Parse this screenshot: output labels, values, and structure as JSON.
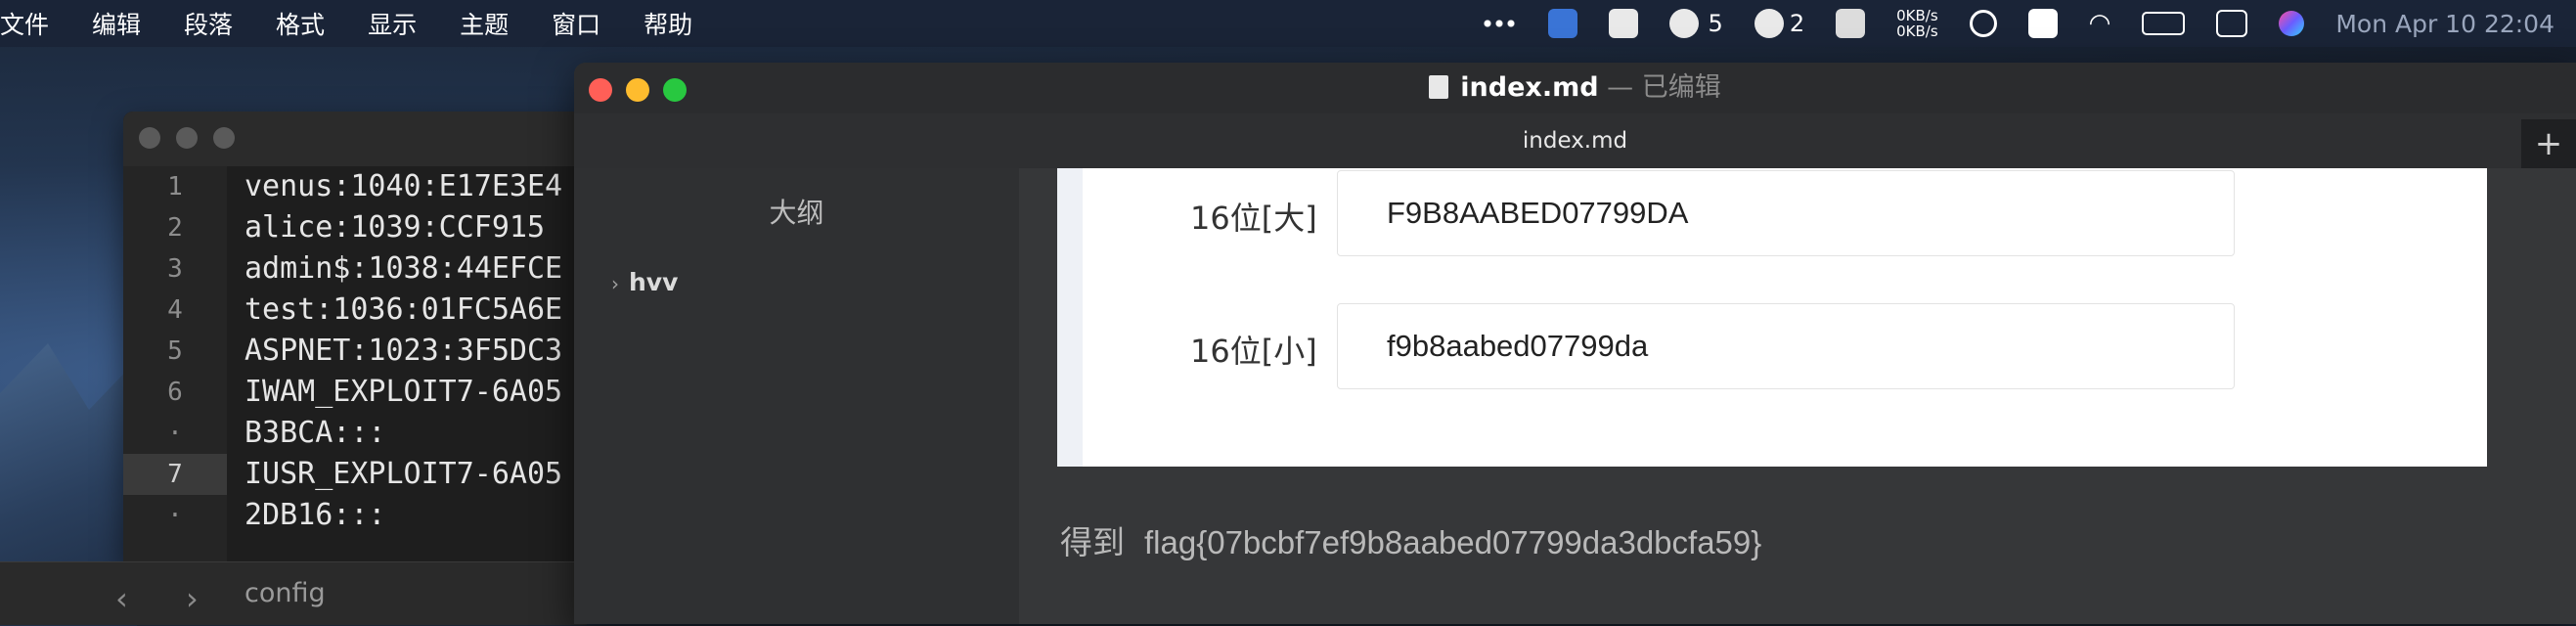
{
  "menubar": {
    "menus": [
      "文件",
      "编辑",
      "段落",
      "格式",
      "显示",
      "主题",
      "窗口",
      "帮助"
    ],
    "wechat_count": "5",
    "qq_count": "2",
    "net_up": "0KB/s",
    "net_down": "0KB/s",
    "clock": "Mon Apr 10  22:04"
  },
  "code_window": {
    "line_numbers": [
      "1",
      "2",
      "3",
      "4",
      "5",
      "6",
      "·",
      "7",
      "·"
    ],
    "lines": [
      "venus:1040:E17E3E4",
      "alice:1039:CCF915",
      "admin$:1038:44EFCE",
      "test:1036:01FC5A6E",
      "ASPNET:1023:3F5DC3",
      "IWAM_EXPLOIT7-6A05",
      "B3BCA:::",
      "IUSR_EXPLOIT7-6A05",
      "2DB16:::"
    ]
  },
  "bottom_bar": {
    "back": "‹",
    "forward": "›",
    "folder": "config"
  },
  "typora": {
    "title_file": "index.md",
    "title_sep": " — ",
    "title_status": "已编辑",
    "tab": "index.md",
    "plus": "+",
    "outline_title": "大纲",
    "outline_item": "hvv",
    "rows": [
      {
        "label": "16位[大]",
        "value": "F9B8AABED07799DA"
      },
      {
        "label": "16位[小]",
        "value": "f9b8aabed07799da"
      }
    ],
    "result_prefix": "得到",
    "result_flag": "flag{07bcbf7ef9b8aabed07799da3dbcfa59}"
  },
  "colors": {
    "close": "#ff5f57",
    "minimize": "#febc2e",
    "zoom": "#28c840"
  }
}
